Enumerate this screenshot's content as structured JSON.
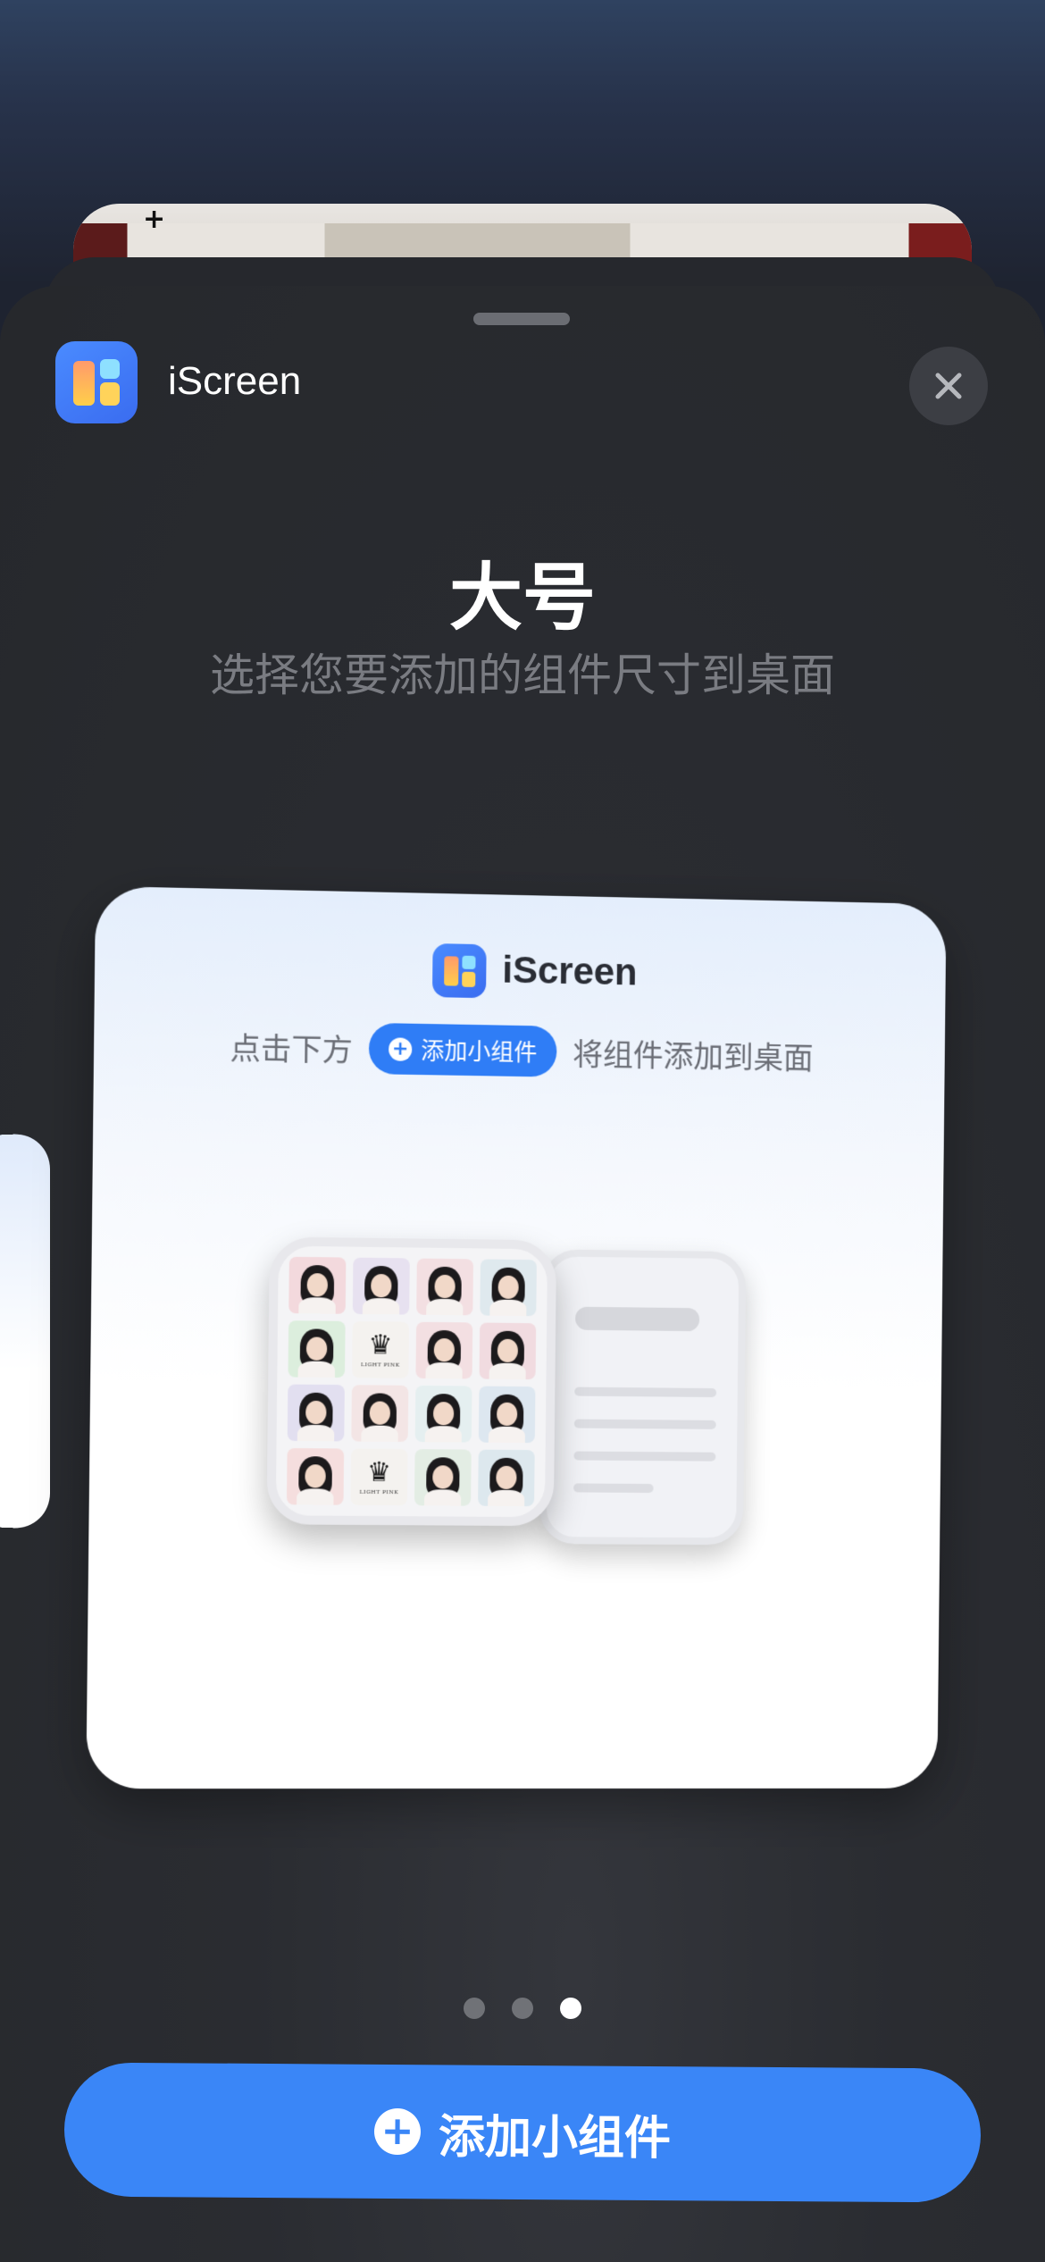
{
  "header": {
    "app_name": "iScreen",
    "close_icon": "close-icon"
  },
  "size_title": "大号",
  "size_subtitle": "选择您要添加的组件尺寸到桌面",
  "widget_preview": {
    "app_name": "iScreen",
    "hint_before": "点击下方",
    "pill_label": "添加小组件",
    "hint_after": "将组件添加到桌面",
    "crown_text": "LIGHT PINK",
    "tile_colors": [
      "#f3d9dd",
      "#e7e1f0",
      "#f3dfe2",
      "#dfe9ee",
      "#dceedd",
      "crown",
      "#f3dfe2",
      "#f1dbe0",
      "#e2dff0",
      "#f3e5e5",
      "#e5eff0",
      "#dde7f0",
      "#f5dede",
      "crown",
      "#e3ede4",
      "#dde8ee"
    ]
  },
  "pagination": {
    "count": 3,
    "active_index": 2
  },
  "add_button": {
    "label": "添加小组件",
    "icon": "plus-circle-icon"
  },
  "colors": {
    "accent": "#3a86f7",
    "sheet": "#2a2c31"
  }
}
